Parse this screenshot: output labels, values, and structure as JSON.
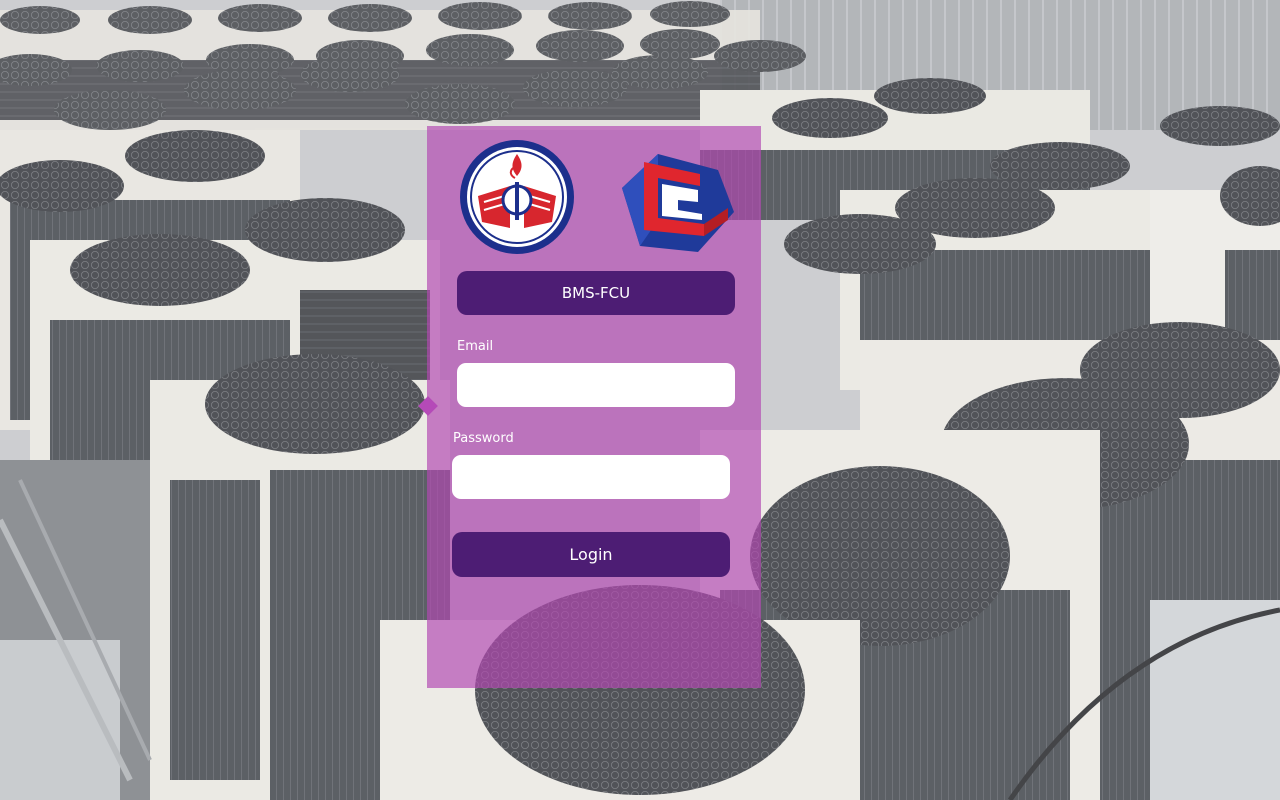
{
  "app": {
    "title": "BMS-FCU"
  },
  "form": {
    "email_label": "Email",
    "email_value": "",
    "password_label": "Password",
    "password_value": "",
    "login_label": "Login"
  },
  "colors": {
    "panel_overlay": "#b248b2",
    "button_bg": "#4d1d74",
    "field_bg": "#ffffff",
    "label_text": "#ffffff"
  },
  "icons": {
    "logo_left": "university-emblem-logo",
    "logo_right": "c-block-logo"
  }
}
